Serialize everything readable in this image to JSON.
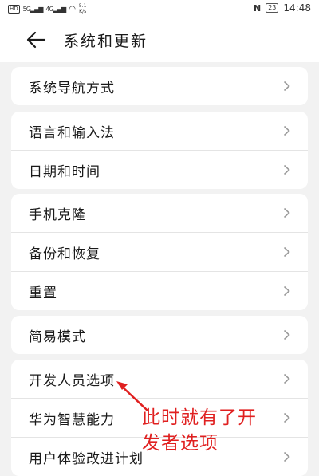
{
  "status_bar": {
    "hd": "HD",
    "signal1": "5G",
    "signal2": "4G",
    "speed_value": "5.1",
    "speed_unit": "K/s",
    "nfc": "N",
    "battery": "23",
    "time": "14:48"
  },
  "header": {
    "title": "系统和更新"
  },
  "groups": [
    {
      "items": [
        "系统导航方式"
      ]
    },
    {
      "items": [
        "语言和输入法",
        "日期和时间"
      ]
    },
    {
      "items": [
        "手机克隆",
        "备份和恢复",
        "重置"
      ]
    },
    {
      "items": [
        "简易模式"
      ]
    },
    {
      "items": [
        "开发人员选项",
        "华为智慧能力",
        "用户体验改进计划"
      ]
    }
  ],
  "annotation": {
    "text": "此时就有了开发者选项",
    "color": "#e02020"
  }
}
